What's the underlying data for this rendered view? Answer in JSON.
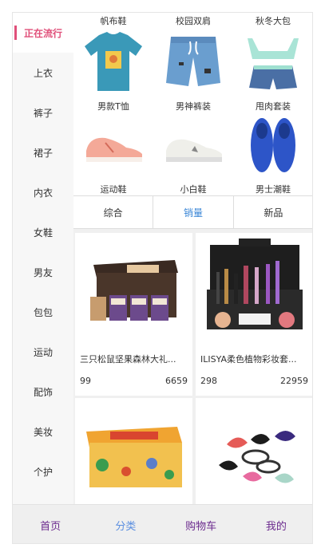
{
  "sidebar": {
    "items": [
      {
        "label": "正在流行",
        "active": true
      },
      {
        "label": "上衣"
      },
      {
        "label": "裤子"
      },
      {
        "label": "裙子"
      },
      {
        "label": "内衣"
      },
      {
        "label": "女鞋"
      },
      {
        "label": "男友"
      },
      {
        "label": "包包"
      },
      {
        "label": "运动"
      },
      {
        "label": "配饰"
      },
      {
        "label": "美妆"
      },
      {
        "label": "个护"
      }
    ]
  },
  "category_grid": {
    "row1_labels": [
      "帆布鞋",
      "校园双肩",
      "秋冬大包"
    ],
    "row2_labels": [
      "男款T恤",
      "男神裤装",
      "甩肉套装"
    ],
    "row3_labels": [
      "运动鞋",
      "小白鞋",
      "男士潮鞋"
    ]
  },
  "sort_tabs": [
    {
      "label": "综合"
    },
    {
      "label": "销量",
      "active": true
    },
    {
      "label": "新品"
    }
  ],
  "products": [
    {
      "title": "三只松鼠坚果森林大礼...",
      "price": "99",
      "sales": "6659"
    },
    {
      "title": "ILISYA柔色植物彩妆套...",
      "price": "298",
      "sales": "22959"
    },
    {
      "title": "",
      "price": "",
      "sales": ""
    },
    {
      "title": "",
      "price": "",
      "sales": ""
    }
  ],
  "bottom_nav": [
    {
      "label": "首页"
    },
    {
      "label": "分类",
      "active": true
    },
    {
      "label": "购物车"
    },
    {
      "label": "我的"
    }
  ],
  "colors": {
    "accent": "#e0507a",
    "tab_active": "#3a86d6",
    "nav_text": "#6b2a8e",
    "nav_active": "#5a8ee0"
  }
}
